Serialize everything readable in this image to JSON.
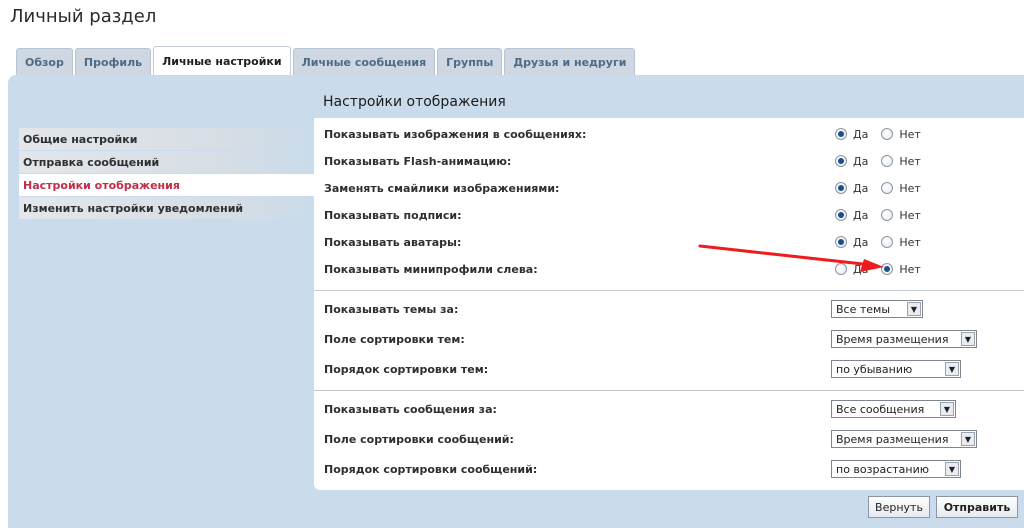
{
  "page": {
    "title": "Личный раздел"
  },
  "tabs": [
    {
      "label": "Обзор",
      "active": false
    },
    {
      "label": "Профиль",
      "active": false
    },
    {
      "label": "Личные настройки",
      "active": true
    },
    {
      "label": "Личные сообщения",
      "active": false
    },
    {
      "label": "Группы",
      "active": false
    },
    {
      "label": "Друзья и недруги",
      "active": false
    }
  ],
  "section_title": "Настройки отображения",
  "side_menu": [
    {
      "label": "Общие настройки",
      "active": false
    },
    {
      "label": "Отправка сообщений",
      "active": false
    },
    {
      "label": "Настройки отображения",
      "active": true
    },
    {
      "label": "Изменить настройки уведомлений",
      "active": false
    }
  ],
  "radio_options": {
    "yes": "Да",
    "no": "Нет"
  },
  "radio_rows": [
    {
      "label": "Показывать изображения в сообщениях:",
      "value": "yes"
    },
    {
      "label": "Показывать Flash-анимацию:",
      "value": "yes"
    },
    {
      "label": "Заменять смайлики изображениями:",
      "value": "yes"
    },
    {
      "label": "Показывать подписи:",
      "value": "yes"
    },
    {
      "label": "Показывать аватары:",
      "value": "yes"
    },
    {
      "label": "Показывать минипрофили слева:",
      "value": "no"
    }
  ],
  "topic_selects": [
    {
      "label": "Показывать темы за:",
      "value": "Все темы"
    },
    {
      "label": "Поле сортировки тем:",
      "value": "Время размещения"
    },
    {
      "label": "Порядок сортировки тем:",
      "value": "по убыванию"
    }
  ],
  "post_selects": [
    {
      "label": "Показывать сообщения за:",
      "value": "Все сообщения"
    },
    {
      "label": "Поле сортировки сообщений:",
      "value": "Время размещения"
    },
    {
      "label": "Порядок сортировки сообщений:",
      "value": "по возрастанию"
    }
  ],
  "buttons": {
    "reset": "Вернуть",
    "submit": "Отправить"
  },
  "colors": {
    "panel_bg": "#cadceb",
    "active_menu_text": "#c42c47",
    "annotation_arrow": "#ee1c1c"
  }
}
